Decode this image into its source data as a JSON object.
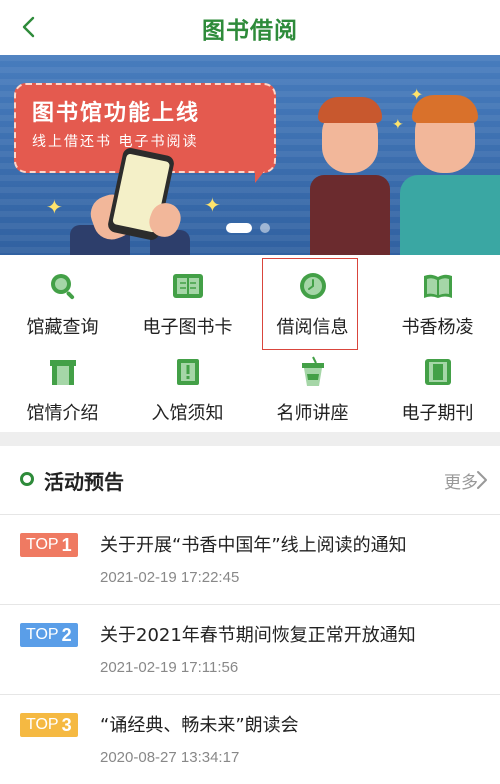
{
  "header": {
    "title": "图书借阅",
    "back_icon": "chevron-left-icon",
    "accent": "#2e8b3a"
  },
  "banner": {
    "title": "图书馆功能上线",
    "subtitle": "线上借还书  电子书阅读",
    "promo_color": "#e45a4f",
    "bg_color": "#3a6db0",
    "slide_count": 2,
    "active_slide": 1
  },
  "menu": {
    "items": [
      {
        "label": "馆藏查询",
        "icon": "search-icon"
      },
      {
        "label": "电子图书卡",
        "icon": "book-card-icon"
      },
      {
        "label": "借阅信息",
        "icon": "clock-icon"
      },
      {
        "label": "书香杨凌",
        "icon": "open-book-icon"
      },
      {
        "label": "馆情介绍",
        "icon": "building-icon"
      },
      {
        "label": "入馆须知",
        "icon": "notice-icon"
      },
      {
        "label": "名师讲座",
        "icon": "cup-icon"
      },
      {
        "label": "电子期刊",
        "icon": "tablet-icon"
      }
    ],
    "icon_color": "#43a047"
  },
  "activity": {
    "title": "活动预告",
    "more_label": "更多",
    "items": [
      {
        "badge_text": "TOP",
        "badge_num": "1",
        "badge_color": "#ef7a62",
        "title": "关于开展“书香中国年”线上阅读的通知",
        "time": "2021-02-19 17:22:45"
      },
      {
        "badge_text": "TOP",
        "badge_num": "2",
        "badge_color": "#5a9ee8",
        "title": "关于2021年春节期间恢复正常开放通知",
        "time": "2021-02-19 17:11:56"
      },
      {
        "badge_text": "TOP",
        "badge_num": "3",
        "badge_color": "#f5b942",
        "title": "“诵经典、畅未来”朗读会",
        "time": "2020-08-27 13:34:17"
      }
    ]
  }
}
